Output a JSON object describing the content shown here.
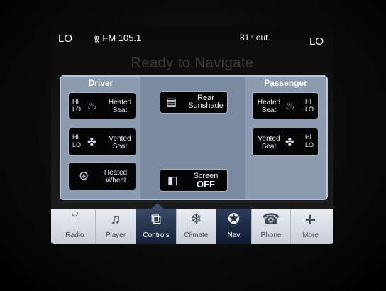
{
  "status": {
    "temp_left": "LO",
    "temp_right": "LO",
    "radio": "FM 105.1",
    "outside_temp": "81",
    "outside_unit": "out."
  },
  "map_message": "Ready to Navigate",
  "panel": {
    "driver_title": "Driver",
    "passenger_title": "Passenger",
    "driver_heated": {
      "hi": "HI",
      "lo": "LO",
      "label1": "Heated",
      "label2": "Seat"
    },
    "driver_vented": {
      "hi": "HI",
      "lo": "LO",
      "label1": "Vented",
      "label2": "Seat"
    },
    "heated_wheel": {
      "label1": "Heated",
      "label2": "Wheel"
    },
    "rear_sunshade": {
      "label1": "Rear",
      "label2": "Sunshade"
    },
    "screen_off": {
      "label1": "Screen",
      "label2": "OFF"
    },
    "passenger_heated": {
      "hi": "HI",
      "lo": "LO",
      "label1": "Heated",
      "label2": "Seat"
    },
    "passenger_vented": {
      "hi": "HI",
      "lo": "LO",
      "label1": "Vented",
      "label2": "Seat"
    }
  },
  "tabs": {
    "radio": "Radio",
    "player": "Player",
    "controls": "Controls",
    "climate": "Climate",
    "nav": "Nav",
    "phone": "Phone",
    "more": "More"
  },
  "icons": {
    "signal": "radio-signal-icon",
    "seat": "seat-icon",
    "fan": "fan-icon",
    "wheel": "steering-wheel-icon",
    "sunshade": "sunshade-icon",
    "screen": "screen-icon"
  }
}
